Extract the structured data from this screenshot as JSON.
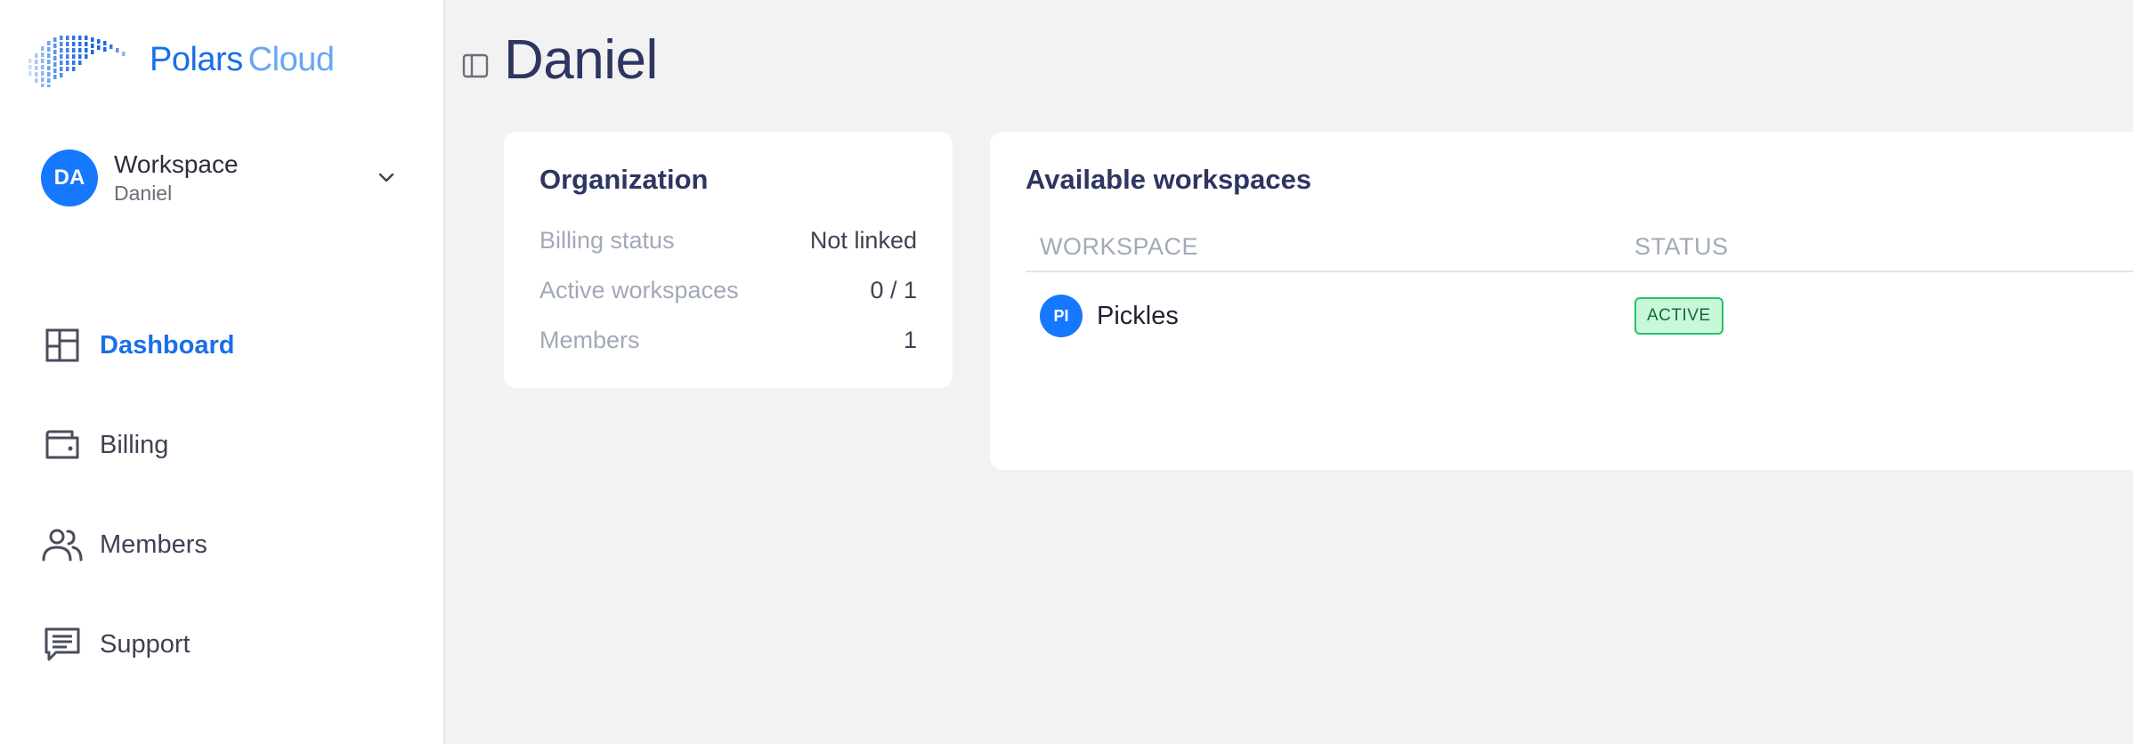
{
  "brand": {
    "name_part1": "Polars",
    "name_part2": "Cloud"
  },
  "workspace_switcher": {
    "initials": "DA",
    "title": "Workspace",
    "subtitle": "Daniel"
  },
  "nav": {
    "items": [
      {
        "label": "Dashboard",
        "icon": "dashboard-icon",
        "active": true
      },
      {
        "label": "Billing",
        "icon": "wallet-icon",
        "active": false
      },
      {
        "label": "Members",
        "icon": "users-icon",
        "active": false
      },
      {
        "label": "Support",
        "icon": "chat-icon",
        "active": false
      }
    ]
  },
  "page": {
    "title": "Daniel"
  },
  "organization": {
    "title": "Organization",
    "rows": [
      {
        "key": "Billing status",
        "value": "Not linked"
      },
      {
        "key": "Active workspaces",
        "value": "0 / 1"
      },
      {
        "key": "Members",
        "value": "1"
      }
    ]
  },
  "workspaces": {
    "title": "Available workspaces",
    "columns": [
      "WORKSPACE",
      "STATUS"
    ],
    "rows": [
      {
        "initials": "PI",
        "name": "Pickles",
        "status": "ACTIVE"
      }
    ]
  },
  "colors": {
    "accent": "#1677ff",
    "brand_dark": "#1a6fe8",
    "brand_light": "#69a6f2",
    "title": "#2d3561",
    "badge_bg": "#c9f7da",
    "badge_border": "#27c267"
  }
}
